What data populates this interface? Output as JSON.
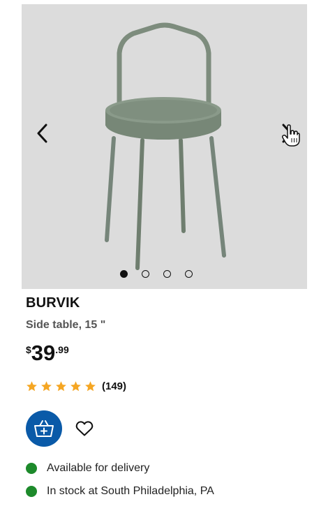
{
  "product": {
    "name": "BURVIK",
    "description": "Side table, 15 \"",
    "price": {
      "currency": "$",
      "integer": "39",
      "decimal": ".99"
    },
    "rating": {
      "stars": 5,
      "count": "(149)"
    }
  },
  "gallery": {
    "image_icon": "side-table-image",
    "prev_icon": "chevron-left-icon",
    "next_icon": "chevron-right-icon",
    "pagination": {
      "total": 4,
      "active_index": 0
    }
  },
  "actions": {
    "add_to_cart_icon": "basket-plus-icon",
    "favorite_icon": "heart-outline-icon"
  },
  "availability": [
    {
      "label": "Available for delivery",
      "status_color": "#1d8a2b"
    },
    {
      "label": "In stock at South Philadelphia, PA",
      "status_color": "#1d8a2b"
    }
  ],
  "colors": {
    "brand_blue": "#0a5aa8",
    "star": "#f5a623",
    "table_green": "#7c8c7c",
    "background": "#dcdcdc"
  }
}
